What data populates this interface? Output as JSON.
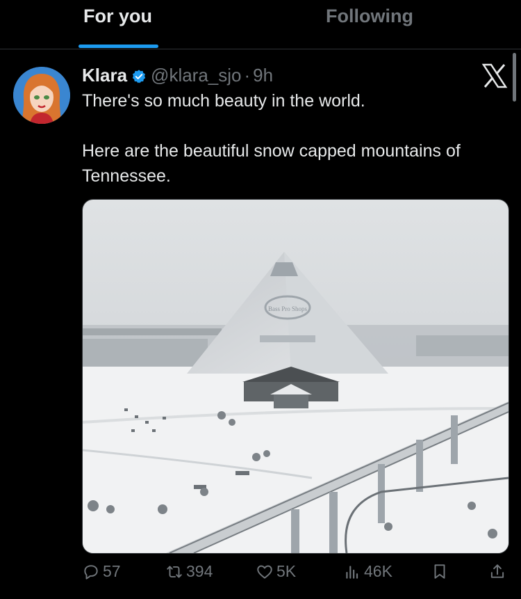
{
  "tabs": [
    {
      "label": "For you",
      "active": true
    },
    {
      "label": "Following",
      "active": false
    }
  ],
  "tweet": {
    "name": "Klara",
    "verified": true,
    "handle": "@klara_sjo",
    "separator": "·",
    "time": "9h",
    "text_line1": "There's so much beauty in the world.",
    "text_line2": "Here are the beautiful snow capped mountains of Tennessee.",
    "media_icon": "snowy-pyramid-photo",
    "sign_text": "Bass Pro Shops"
  },
  "actions": {
    "replies": "57",
    "reposts": "394",
    "likes": "5K",
    "views": "46K"
  },
  "colors": {
    "accent": "#1d9bf0",
    "muted": "#71767b",
    "text": "#e7e9ea",
    "background": "#000000"
  }
}
